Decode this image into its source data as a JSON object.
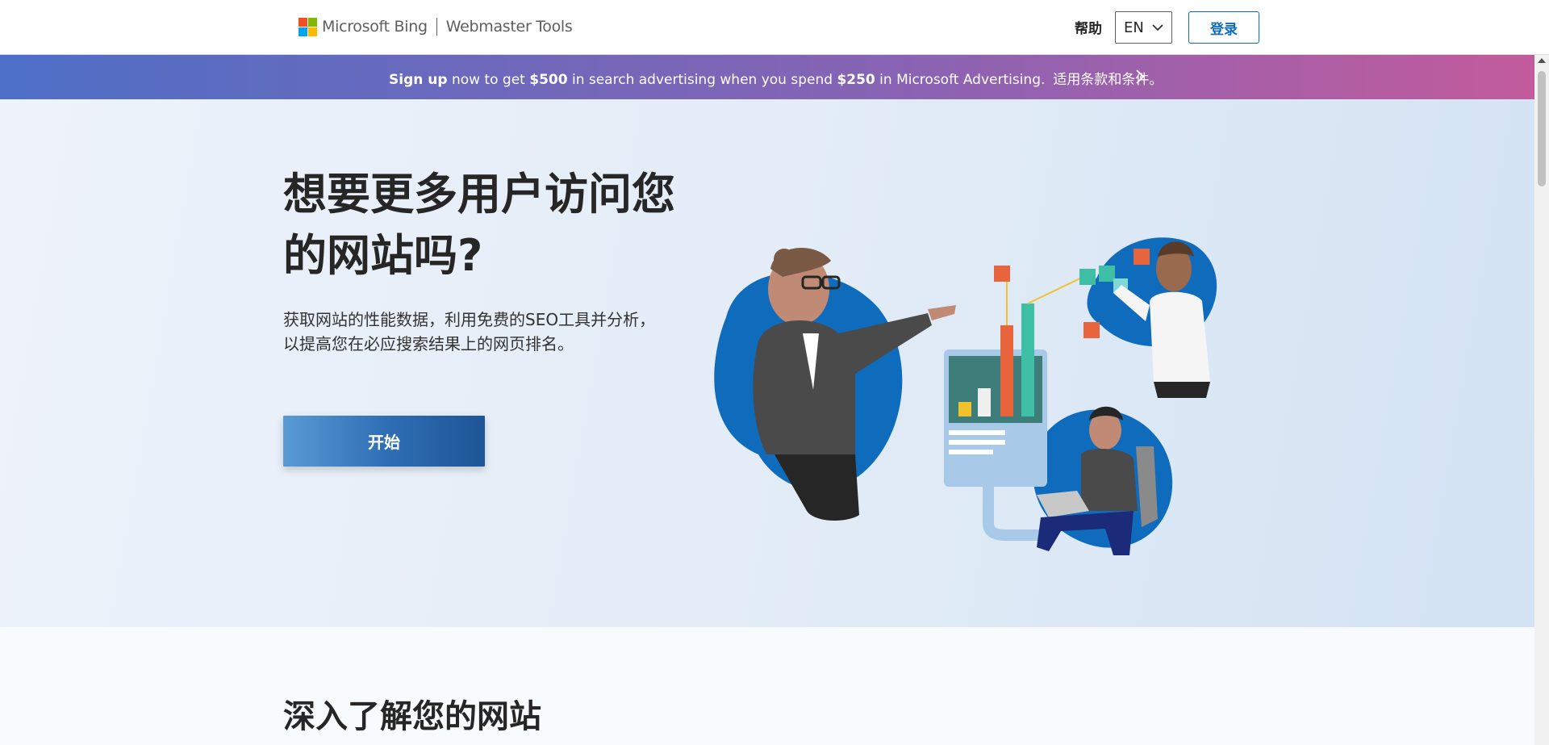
{
  "header": {
    "brand": "Microsoft Bing",
    "product": "Webmaster Tools",
    "help_label": "帮助",
    "language": "EN",
    "login_label": "登录",
    "logo_colors": [
      "#f25022",
      "#7fba00",
      "#00a4ef",
      "#ffb900"
    ]
  },
  "promo": {
    "signup": "Sign up",
    "text1": " now to get ",
    "amount1": "$500",
    "text2": " in search advertising when you spend ",
    "amount2": "$250",
    "text3": " in Microsoft Advertising.",
    "terms": "适用条款和条件。",
    "arrow_icon": "chevron-right-icon"
  },
  "hero": {
    "title": "想要更多用户访问您的网站吗?",
    "description": "获取网站的性能数据，利用免费的SEO工具并分析，以提高您在必应搜索结果上的网页排名。",
    "start_label": "开始"
  },
  "section2": {
    "title": "深入了解您的网站"
  },
  "colors": {
    "accent": "#0f6cbd",
    "promo_start": "#4d6fc6",
    "promo_end": "#c25b9c",
    "blob_blue": "#0f6cbd"
  }
}
